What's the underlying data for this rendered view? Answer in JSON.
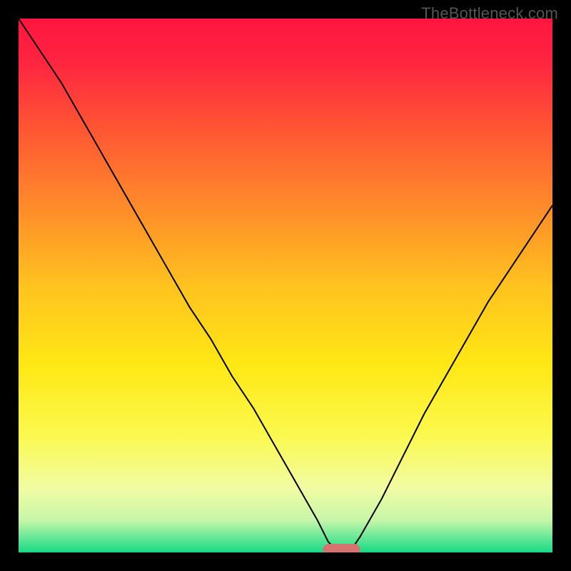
{
  "watermark": {
    "text": "TheBottleneck.com"
  },
  "chart_data": {
    "type": "line",
    "title": "",
    "xlabel": "",
    "ylabel": "",
    "xlim": [
      0,
      100
    ],
    "ylim": [
      0,
      100
    ],
    "grid": false,
    "legend": false,
    "background_gradient": {
      "stops": [
        {
          "pos": 0.0,
          "color": "#ff153f"
        },
        {
          "pos": 0.08,
          "color": "#ff2440"
        },
        {
          "pos": 0.2,
          "color": "#ff5334"
        },
        {
          "pos": 0.35,
          "color": "#ff8a2a"
        },
        {
          "pos": 0.5,
          "color": "#ffc21f"
        },
        {
          "pos": 0.65,
          "color": "#ffe815"
        },
        {
          "pos": 0.78,
          "color": "#fbf94e"
        },
        {
          "pos": 0.88,
          "color": "#f1fca3"
        },
        {
          "pos": 0.94,
          "color": "#c6f6a9"
        },
        {
          "pos": 0.975,
          "color": "#5fe696"
        },
        {
          "pos": 1.0,
          "color": "#17d985"
        }
      ]
    },
    "series": [
      {
        "name": "bottleneck-curve",
        "color": "#000000",
        "stroke_width": 2,
        "x": [
          0,
          4,
          8,
          12,
          16,
          20,
          24,
          28,
          32,
          36,
          40,
          44,
          48,
          52,
          56,
          58,
          60,
          62,
          64,
          68,
          72,
          76,
          80,
          84,
          88,
          92,
          96,
          100
        ],
        "values": [
          100,
          94,
          88,
          81,
          74,
          67,
          60,
          53,
          46,
          40,
          33,
          27,
          20,
          13,
          6,
          2,
          0,
          0,
          3,
          10,
          18,
          26,
          33,
          40,
          47,
          53,
          59,
          65
        ]
      }
    ],
    "marker": {
      "name": "optimal-range",
      "shape": "capsule",
      "color": "#d4736f",
      "x_start": 57,
      "x_end": 64,
      "y": 0.5,
      "height": 2.2
    }
  }
}
